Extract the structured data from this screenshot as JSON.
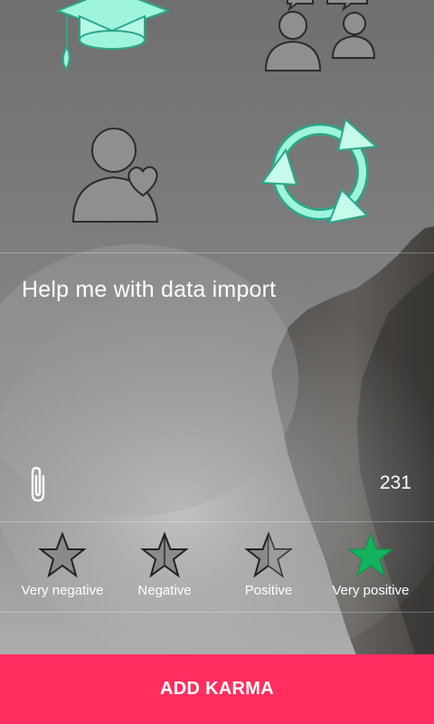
{
  "karma": {
    "message": "Help me with data import",
    "char_count": "231"
  },
  "icons": {
    "top_left": "graduation-cap-icon",
    "top_right": "conversation-icon",
    "mid_left": "user-heart-icon",
    "mid_right": "refresh-icon",
    "attach": "paperclip-icon"
  },
  "rating": {
    "options": [
      {
        "label": "Very negative",
        "selected": false
      },
      {
        "label": "Negative",
        "selected": false
      },
      {
        "label": "Positive",
        "selected": false
      },
      {
        "label": "Very positive",
        "selected": true
      }
    ]
  },
  "actions": {
    "add_label": "ADD KARMA"
  },
  "colors": {
    "accent_mint": "#9ff5dc",
    "accent_teal": "#2aa88a",
    "selected_star": "#12b35c",
    "button": "#ff2e5e"
  }
}
